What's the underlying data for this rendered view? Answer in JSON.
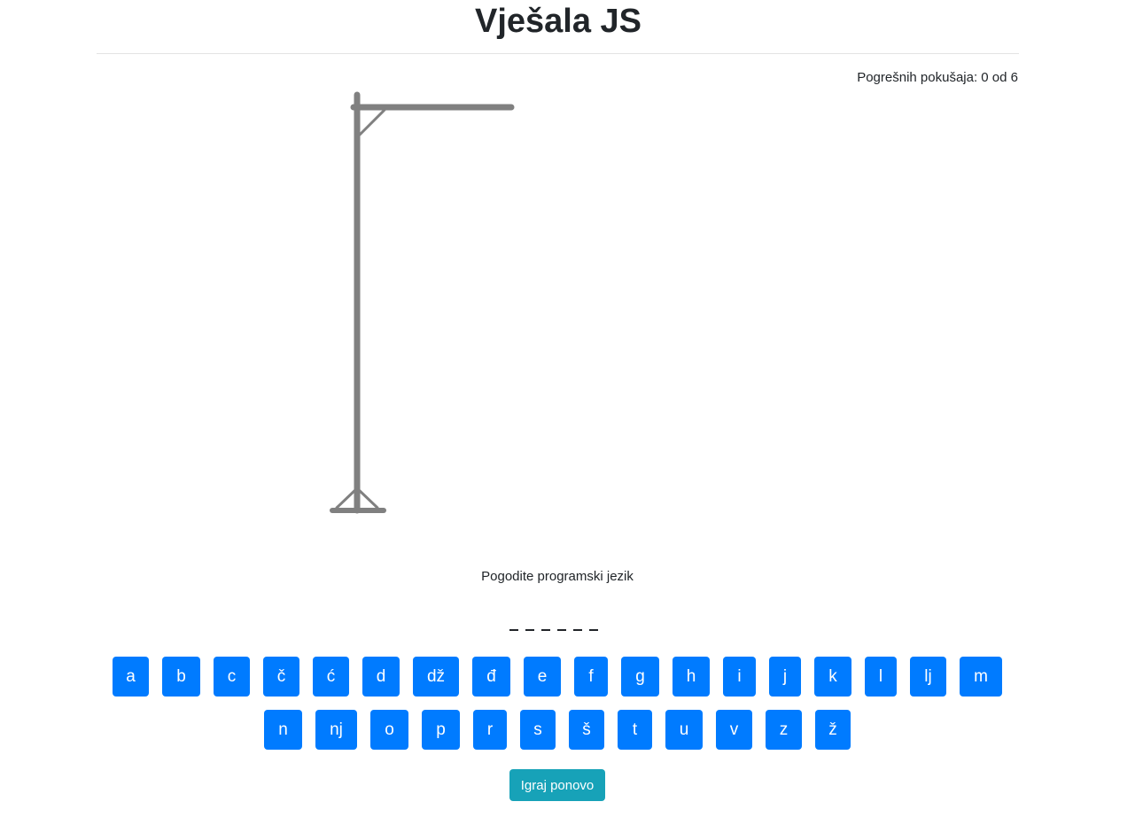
{
  "header": {
    "title": "Vješala JS"
  },
  "status": {
    "wrong_attempts_text": "Pogrešnih pokušaja: 0 od 6",
    "wrong": 0,
    "max": 6
  },
  "game": {
    "hint": "Pogodite programski jezik",
    "word_length": 6,
    "word_display": [
      "_",
      "_",
      "_",
      "_",
      "_",
      "_"
    ]
  },
  "keyboard": {
    "row1": [
      "a",
      "b",
      "c",
      "č",
      "ć",
      "d",
      "dž",
      "đ",
      "e",
      "f",
      "g",
      "h",
      "i",
      "j",
      "k",
      "l",
      "lj",
      "m"
    ],
    "row2": [
      "n",
      "nj",
      "o",
      "p",
      "r",
      "s",
      "š",
      "t",
      "u",
      "v",
      "z",
      "ž"
    ]
  },
  "actions": {
    "play_again_label": "Igraj ponovo"
  },
  "colors": {
    "key": "#007bff",
    "play_again": "#17a2b8",
    "gallows": "#808080"
  },
  "icons": {
    "gallows": "gallows-drawing"
  }
}
